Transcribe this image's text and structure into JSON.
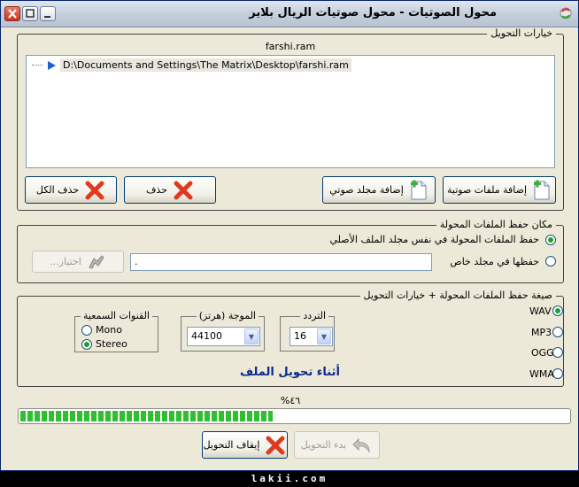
{
  "window": {
    "title": "محول الصوتيات - محول صوتيات الريال بلاير"
  },
  "options_group": {
    "label": "خيارات التحويل",
    "list_header": "farshi.ram",
    "files": [
      "D:\\Documents and Settings\\The Matrix\\Desktop\\farshi.ram"
    ],
    "buttons": {
      "add_audio_files": "إضافة ملفات صوتية",
      "add_audio_folder": "إضافة مجلد صوتي",
      "delete": "حذف",
      "delete_all": "حذف الكل"
    }
  },
  "save_location": {
    "label": "مكان حفظ الملفات المحولة",
    "same_folder_label": "حفظ الملفات المحولة في نفس مجلد الملف الأصلي",
    "custom_folder_label": "حفظها في مجلد خاص",
    "selected": "same_folder",
    "path_value": ".",
    "browse_label": "اختيار..."
  },
  "format_group": {
    "label": "صيغة حفظ الملفات المحولة + خيارات التحويل",
    "formats": [
      "WAV",
      "MP3",
      "OGG",
      "WMA"
    ],
    "selected_format": "WAV",
    "frequency": {
      "label": "التردد",
      "value": "16"
    },
    "sample_rate": {
      "label": "الموجة (هرتز)",
      "value": "44100"
    },
    "channels": {
      "label": "القنوات السمعية",
      "options": [
        "Mono",
        "Stereo"
      ],
      "selected": "Stereo"
    },
    "status_text": "أثناء تحويل الملف"
  },
  "progress": {
    "percent_label": "%٤٦",
    "percent": 46
  },
  "actions": {
    "start_label": "بدء التحويل",
    "stop_label": "إيقاف التحويل"
  },
  "footer": {
    "text": "lakii.com"
  },
  "colors": {
    "accent": "#21a121",
    "status": "#0b2a8a",
    "delete_icon": "#e03a1e"
  }
}
